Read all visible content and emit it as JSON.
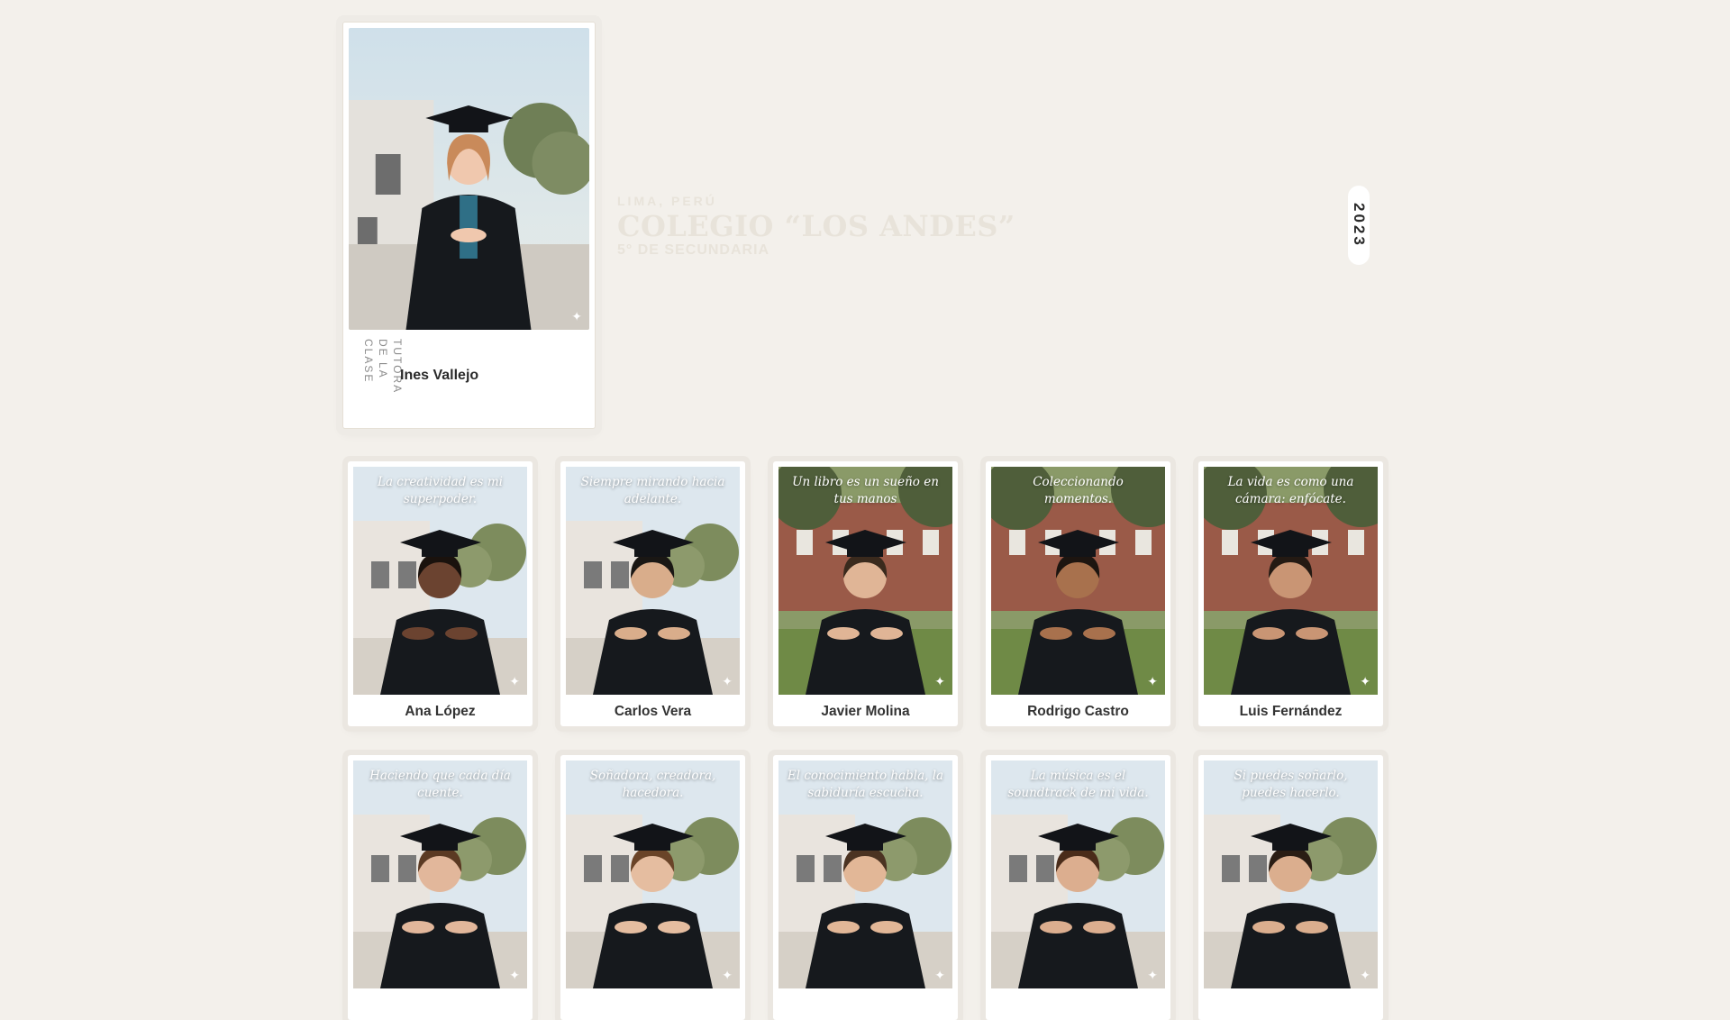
{
  "header": {
    "city": "LIMA, PERÚ",
    "school": "COLEGIO “LOS ANDES”",
    "grade": "5° DE SECUNDARIA",
    "year": "2023"
  },
  "teacher": {
    "role": "TUTORA DE LA CLASE",
    "name": "Ines Vallejo",
    "icon": "sparkle-icon"
  },
  "students_row1": [
    {
      "name": "Ana López",
      "quote": "La creatividad es mi superpoder.",
      "skin": "#6b4330",
      "hair": "#1a120d",
      "bg": "campus"
    },
    {
      "name": "Carlos Vera",
      "quote": "Siempre mirando hacia adelante.",
      "skin": "#d9ad8b",
      "hair": "#1a1714",
      "bg": "campus"
    },
    {
      "name": "Javier Molina",
      "quote": "Un libro es un sueño en tus manos",
      "skin": "#e0b596",
      "hair": "#3a2a1d",
      "bg": "brick"
    },
    {
      "name": "Rodrigo Castro",
      "quote": "Coleccionando momentos.",
      "skin": "#a8714d",
      "hair": "#1d1510",
      "bg": "brick"
    },
    {
      "name": "Luis Fernández",
      "quote": "La vida es como una cámara: enfócate.",
      "skin": "#c99574",
      "hair": "#241a13",
      "bg": "brick"
    }
  ],
  "students_row2": [
    {
      "name": "",
      "quote": "Haciendo que cada día cuente.",
      "skin": "#e2b79b",
      "hair": "#5b3a23",
      "bg": "campus"
    },
    {
      "name": "",
      "quote": "Soñadora, creadora, hacedora.",
      "skin": "#e5bda0",
      "hair": "#6a4428",
      "bg": "campus"
    },
    {
      "name": "",
      "quote": "El conocimiento habla, la sabiduría escucha.",
      "skin": "#e2b797",
      "hair": "#4b3322",
      "bg": "campus"
    },
    {
      "name": "",
      "quote": "La música es el soundtrack de mi vida.",
      "skin": "#dcae8f",
      "hair": "#4a2c1a",
      "bg": "campus"
    },
    {
      "name": "",
      "quote": "Si puedes soñarlo, puedes hacerlo.",
      "skin": "#dbae8e",
      "hair": "#2a1d14",
      "bg": "campus"
    }
  ],
  "colors": {
    "background": "#f3f0eb",
    "gown": "#16191d",
    "cap": "#121418"
  }
}
